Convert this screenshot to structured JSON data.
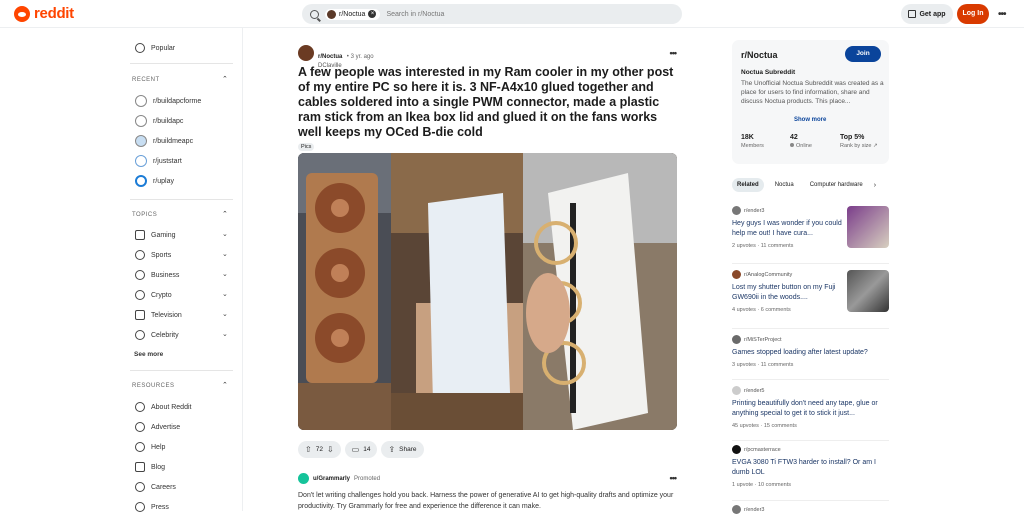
{
  "header": {
    "logo_text": "reddit",
    "search_chip": "r/Noctua",
    "search_placeholder": "Search in r/Noctua",
    "get_app": "Get app",
    "login": "Log In"
  },
  "sidebar": {
    "popular": "Popular",
    "recent_heading": "RECENT",
    "recent": [
      "r/buildapcforme",
      "r/buildapc",
      "r/buildmeapc",
      "r/juststart",
      "r/uplay"
    ],
    "topics_heading": "TOPICS",
    "topics": [
      "Gaming",
      "Sports",
      "Business",
      "Crypto",
      "Television",
      "Celebrity"
    ],
    "see_more": "See more",
    "resources_heading": "RESOURCES",
    "resources": [
      "About Reddit",
      "Advertise",
      "Help",
      "Blog",
      "Careers",
      "Press"
    ]
  },
  "post": {
    "subreddit": "r/Noctua",
    "time": "• 3 yr. ago",
    "user": "DClaville",
    "title": "A few people was interested in my Ram cooler in my other post of my entire PC so here it is. 3 NF-A4x10 glued together and cables soldered into a single PWM connector, made a plastic ram stick from an Ikea box lid and glued it on the fans works well keeps my OCed B-die cold",
    "flair": "Pics",
    "votes": "72",
    "comments": "14",
    "share": "Share"
  },
  "promo": {
    "user": "u/Grammarly",
    "tag": "Promoted",
    "text": "Don't let writing challenges hold you back. Harness the power of generative AI to get high-quality drafts and optimize your productivity. Try Grammarly for free and experience the difference it can make."
  },
  "community": {
    "name": "r/Noctua",
    "join": "Join",
    "subtitle": "Noctua Subreddit",
    "description": "The Unofficial Noctua Subreddit was created as a place for users to find information, share and discuss Noctua products. This place...",
    "show_more": "Show more",
    "members_value": "18K",
    "members_label": "Members",
    "online_value": "42",
    "online_label": "Online",
    "rank_value": "Top 5%",
    "rank_label": "Rank by size"
  },
  "related_tabs": [
    "Related",
    "Noctua",
    "Computer hardware"
  ],
  "related": [
    {
      "sub": "r/ender3",
      "title": "Hey guys I was wonder if you could help me out! I have cura...",
      "upvotes": "2 upvotes",
      "comments": "11 comments"
    },
    {
      "sub": "r/AnalogCommunity",
      "title": "Lost my shutter button on my Fuji GW690ii in the woods....",
      "upvotes": "4 upvotes",
      "comments": "6 comments"
    },
    {
      "sub": "r/MiSTerProject",
      "title": "Games stopped loading after latest update?",
      "upvotes": "3 upvotes",
      "comments": "11 comments"
    },
    {
      "sub": "r/ender5",
      "title": "Printing beautifully don't need any tape, glue or anything special to get it to stick it just...",
      "upvotes": "45 upvotes",
      "comments": "15 comments"
    },
    {
      "sub": "r/pcmasterrace",
      "title": "EVGA 3080 Ti FTW3 harder to install? Or am I dumb LOL",
      "upvotes": "1 upvote",
      "comments": "10 comments"
    },
    {
      "sub": "r/ender3",
      "title": "",
      "upvotes": "",
      "comments": ""
    }
  ]
}
